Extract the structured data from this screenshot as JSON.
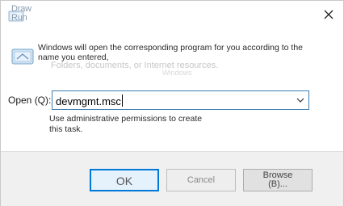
{
  "window": {
    "title_line1": "Draw",
    "title_line2": "Run",
    "close_label": "Close"
  },
  "dialog": {
    "description": "Windows will open the corresponding program for you according to the name you entered,",
    "ghost_text": "Folders, documents, or Internet resources.",
    "ghost_text_2": "Windows",
    "open_label": "Open (Q):",
    "input_value": "devmgmt.msc",
    "admin_note": "Use administrative permissions to create this task."
  },
  "buttons": {
    "ok": "OK",
    "cancel": "Cancel",
    "browse_line1": "Browse",
    "browse_line2": "(B)..."
  },
  "colors": {
    "accent": "#0078d7",
    "input_border": "#3c7fb1",
    "footer_bg": "#f0f0f0"
  },
  "icons": {
    "app": "run-app-icon",
    "run": "run-dialog-icon",
    "close": "close-icon",
    "dropdown": "chevron-down-icon"
  }
}
